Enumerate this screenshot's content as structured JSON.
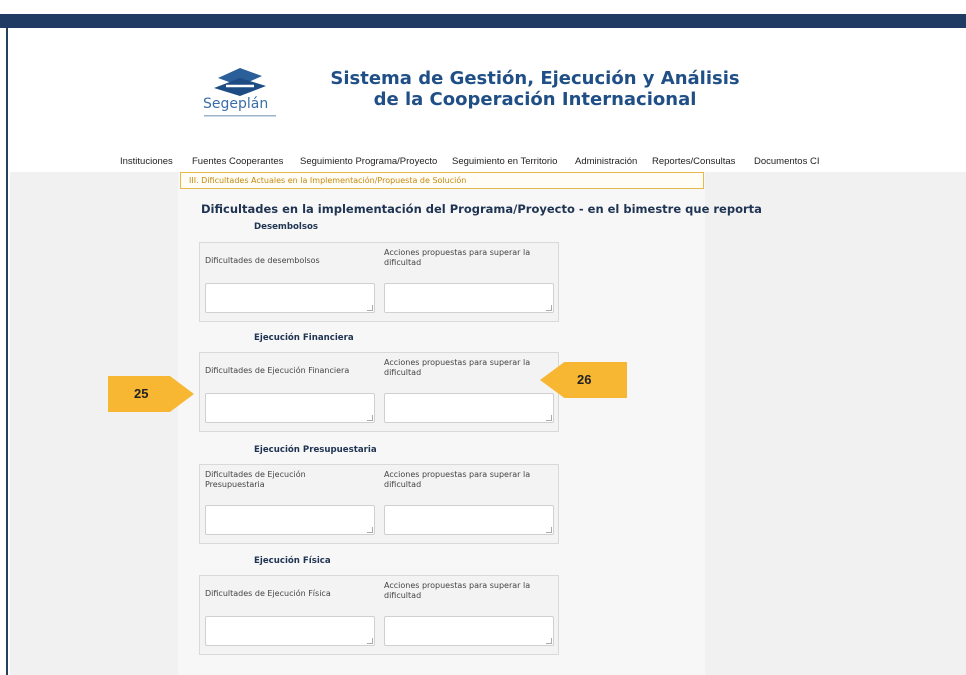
{
  "header": {
    "logo_text": "Segeplán",
    "title_line1": "Sistema de Gestión, Ejecución y Análisis",
    "title_line2": "de la Cooperación Internacional"
  },
  "nav": {
    "items": [
      "Instituciones",
      "Fuentes Cooperantes",
      "Seguimiento Programa/Proyecto",
      "Seguimiento en Territorio",
      "Administración",
      "Reportes/Consultas",
      "Documentos CI"
    ]
  },
  "section_tab": "III. Dificultades Actuales en la Implementación/Propuesta de Solución",
  "main_heading": "Dificultades en la implementación del Programa/Proyecto - en el bimestre que reporta",
  "groups": [
    {
      "title": "Desembolsos",
      "left_label": "Dificultades de desembolsos",
      "right_label": "Acciones propuestas para superar la dificultad"
    },
    {
      "title": "Ejecución Financiera",
      "left_label": "Dificultades de Ejecución Financiera",
      "right_label": "Acciones propuestas para superar la dificultad"
    },
    {
      "title": "Ejecución Presupuestaria",
      "left_label": "Dificultades de Ejecución Presupuestaria",
      "right_label": "Acciones propuestas para superar la dificultad"
    },
    {
      "title": "Ejecución Física",
      "left_label": "Dificultades de Ejecución Física",
      "right_label": "Acciones propuestas para superar la dificultad"
    }
  ],
  "callouts": {
    "left": "25",
    "right": "26"
  },
  "colors": {
    "topbar": "#1f3a63",
    "title": "#1f4f86",
    "callout": "#f7b733",
    "tab_border": "#e8b94a"
  }
}
